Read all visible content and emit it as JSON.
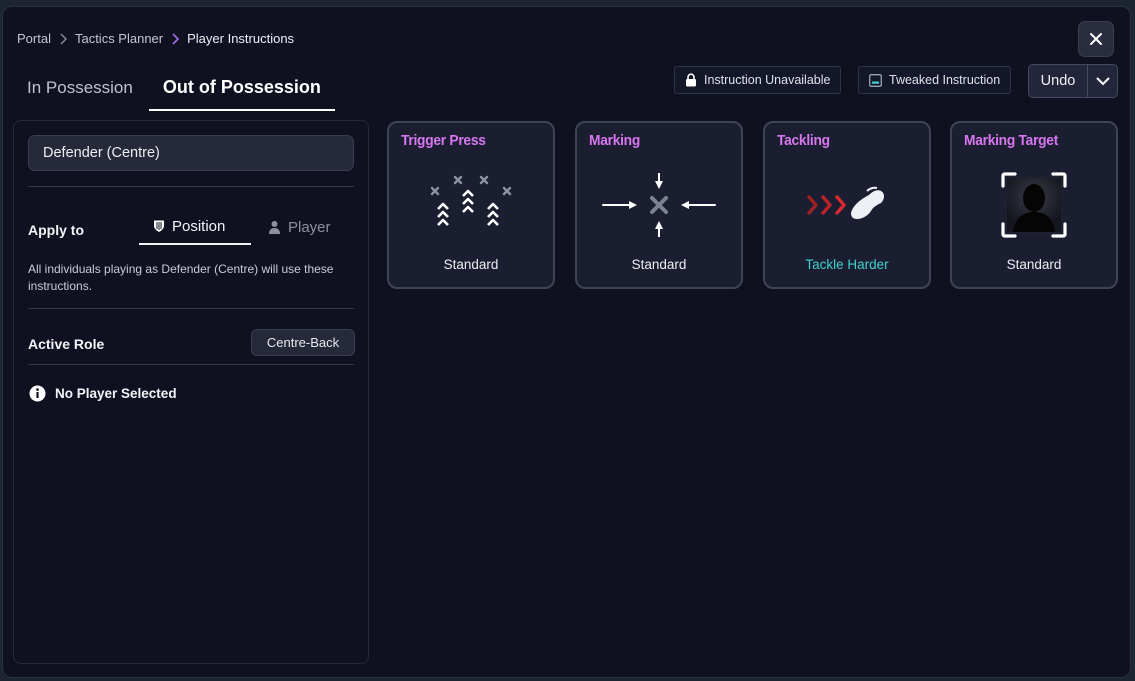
{
  "breadcrumb": [
    "Portal",
    "Tactics Planner",
    "Player Instructions"
  ],
  "tabs": [
    {
      "label": "In Possession",
      "active": false
    },
    {
      "label": "Out of Possession",
      "active": true
    }
  ],
  "legend": {
    "unavailable": "Instruction Unavailable",
    "tweaked": "Tweaked Instruction"
  },
  "undo_label": "Undo",
  "sidebar": {
    "position_select": "Defender (Centre)",
    "apply_to_label": "Apply to",
    "apply_options": [
      "Position",
      "Player"
    ],
    "apply_selected": "Position",
    "apply_description": "All individuals playing as Defender (Centre) will use these instructions.",
    "active_role_label": "Active Role",
    "active_role_value": "Centre-Back",
    "no_player_text": "No Player Selected"
  },
  "instructions": [
    {
      "title": "Trigger Press",
      "value": "Standard",
      "tweaked": false,
      "icon": "trigger-press-icon"
    },
    {
      "title": "Marking",
      "value": "Standard",
      "tweaked": false,
      "icon": "marking-icon"
    },
    {
      "title": "Tackling",
      "value": "Tackle Harder",
      "tweaked": true,
      "icon": "tackling-boot-icon"
    },
    {
      "title": "Marking Target",
      "value": "Standard",
      "tweaked": false,
      "icon": "player-silhouette-icon"
    }
  ],
  "colors": {
    "background": "#0f1121",
    "card_title": "#d776ef",
    "tweaked_value": "#3fd1cf",
    "arrow_red": "#c0262c"
  }
}
